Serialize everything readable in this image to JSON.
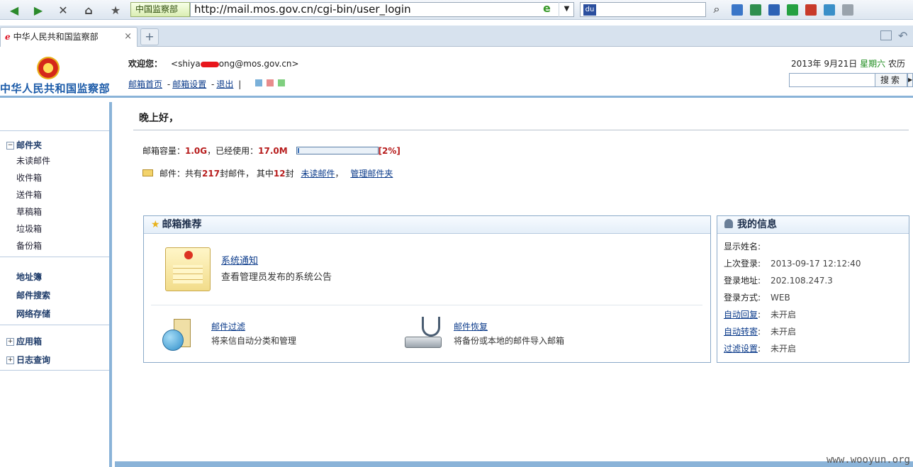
{
  "browser": {
    "zone_label": "中国监察部",
    "url": "http://mail.mos.gov.cn/cgi-bin/user_login",
    "tab_title": "中华人民共和国监察部",
    "tab_close": "×",
    "new_tab": "+"
  },
  "header": {
    "org_name": "中华人民共和国监察部",
    "welcome_label": "欢迎您：",
    "email_prefix": "<shiya",
    "email_suffix": "ong@mos.gov.cn>",
    "nav": {
      "home": "邮箱首页",
      "settings": "邮箱设置",
      "logout": "退出",
      "sep": "-",
      "bar": "|"
    },
    "skin_colors": [
      "#7ab0d9",
      "#e88c8c",
      "#7fcf7f"
    ],
    "date": "2013年  9月21日",
    "weekday": "星期六",
    "lunar": "农历",
    "search_button": "搜索"
  },
  "sidebar": {
    "folders_title": "邮件夹",
    "folders": [
      "未读邮件",
      "收件箱",
      "送件箱",
      "草稿箱",
      "垃圾箱",
      "备份箱"
    ],
    "links": [
      "地址簿",
      "邮件搜索",
      "网络存储"
    ],
    "apps": "应用箱",
    "logs": "日志查询",
    "expand_minus": "−",
    "expand_plus": "+"
  },
  "main": {
    "greeting": "晚上好，",
    "quota_label": "邮箱容量：",
    "quota_total": "1.0G",
    "used_label": "，已经使用：",
    "quota_used": "17.0M",
    "usage_percent_text": "[2%]",
    "usage_fraction": 0.02,
    "mail_prefix": "邮件：共有",
    "mail_total": "217",
    "mail_mid": "封邮件，  其中",
    "mail_unread": "12",
    "mail_suffix": "封",
    "unread_link": "未读邮件",
    "comma": "，",
    "manage_link": "管理邮件夹"
  },
  "recommend": {
    "title": "邮箱推荐",
    "notice_link": "系统通知",
    "notice_desc": "查看管理员发布的系统公告",
    "filter_link": "邮件过滤",
    "filter_desc": "将来信自动分类和管理",
    "restore_link": "邮件恢复",
    "restore_desc": "将备份或本地的邮件导入邮箱"
  },
  "myinfo": {
    "title": "我的信息",
    "display_name_label": "显示姓名:",
    "last_login_label": "上次登录:",
    "last_login_value": "2013-09-17 12:12:40",
    "login_addr_label": "登录地址:",
    "login_addr_value": "202.108.247.3",
    "login_method_label": "登录方式:",
    "login_method_value": "WEB",
    "auto_reply_label": "自动回复",
    "auto_forward_label": "自动转寄",
    "filter_settings_label": "过滤设置",
    "colon": ":",
    "status_off": "未开启"
  },
  "watermark": "www.wooyun.org"
}
